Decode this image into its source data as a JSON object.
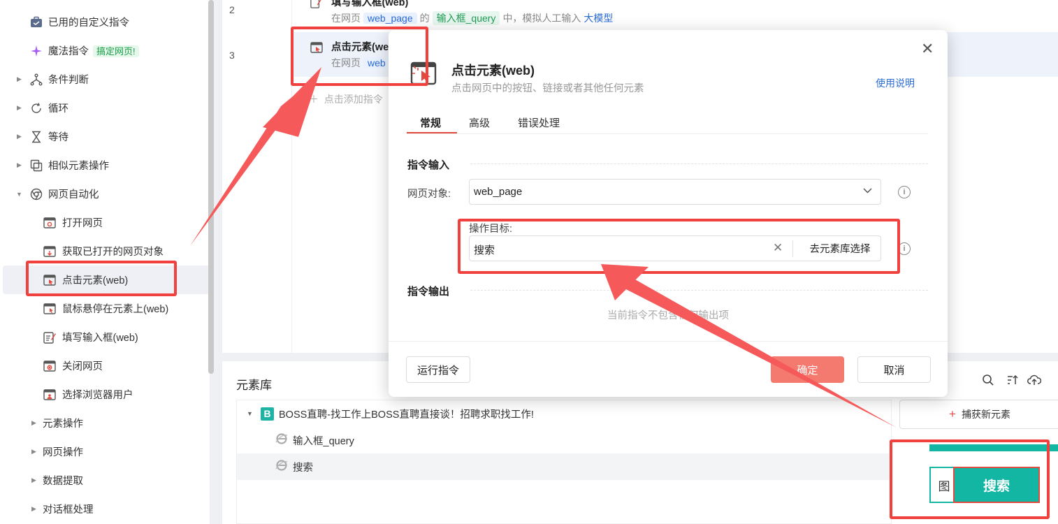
{
  "sidebar": {
    "items": [
      {
        "label": "已用的自定义指令",
        "icon": "briefcase-icon",
        "indent": 0,
        "caret": false
      },
      {
        "label": "魔法指令",
        "icon": "sparkle-icon",
        "indent": 0,
        "caret": false,
        "badge": "搞定网页!"
      },
      {
        "label": "条件判断",
        "icon": "branch-icon",
        "indent": 0,
        "caret": true
      },
      {
        "label": "循环",
        "icon": "loop-icon",
        "indent": 0,
        "caret": true
      },
      {
        "label": "等待",
        "icon": "hourglass-icon",
        "indent": 0,
        "caret": true
      },
      {
        "label": "相似元素操作",
        "icon": "copy-icon",
        "indent": 0,
        "caret": true
      },
      {
        "label": "网页自动化",
        "icon": "chrome-icon",
        "indent": 0,
        "caret": true,
        "expanded": true
      },
      {
        "label": "打开网页",
        "icon": "browser-open-icon",
        "indent": 1
      },
      {
        "label": "获取已打开的网页对象",
        "icon": "browser-get-icon",
        "indent": 1
      },
      {
        "label": "点击元素(web)",
        "icon": "click-element-icon",
        "indent": 1,
        "active": true
      },
      {
        "label": "鼠标悬停在元素上(web)",
        "icon": "hover-icon",
        "indent": 1
      },
      {
        "label": "填写输入框(web)",
        "icon": "edit-input-icon",
        "indent": 1
      },
      {
        "label": "关闭网页",
        "icon": "browser-close-icon",
        "indent": 1
      },
      {
        "label": "选择浏览器用户",
        "icon": "browser-user-icon",
        "indent": 1
      },
      {
        "label": "元素操作",
        "indent": 2,
        "caret": true
      },
      {
        "label": "网页操作",
        "indent": 2,
        "caret": true
      },
      {
        "label": "数据提取",
        "indent": 2,
        "caret": true
      },
      {
        "label": "对话框处理",
        "indent": 2,
        "caret": true
      }
    ]
  },
  "commands": {
    "row2": {
      "num": "2",
      "title": "填写输入框(web)",
      "desc_prefix": "在网页",
      "page_tag": "web_page",
      "desc_of": "的",
      "input_tag": "输入框_query",
      "desc_mid": "中，模拟人工输入",
      "link": "大模型"
    },
    "row3": {
      "num": "3",
      "title": "点击元素(we",
      "desc_prefix": "在网页",
      "page_tag": "web"
    },
    "add_label": "点击添加指令"
  },
  "modal": {
    "title": "点击元素(web)",
    "subtitle": "点击网页中的按钮、链接或者其他任何元素",
    "help_link": "使用说明",
    "tabs": [
      "常规",
      "高级",
      "错误处理"
    ],
    "input_section": "指令输入",
    "page_label": "网页对象:",
    "page_value": "web_page",
    "target_label": "操作目标:",
    "target_value": "搜索",
    "target_button": "去元素库选择",
    "output_section": "指令输出",
    "no_output": "当前指令不包含任何输出项",
    "run_button": "运行指令",
    "ok_button": "确定",
    "cancel_button": "取消"
  },
  "element_library": {
    "title": "元素库",
    "tools": [
      "search-icon",
      "sort-icon",
      "upload-icon"
    ],
    "group": {
      "badge": "B",
      "title": "BOSS直聘-找工作上BOSS直聘直接谈！招聘求职找工作!"
    },
    "items": [
      "输入框_query",
      "搜索"
    ],
    "capture_button": "捕获新元素",
    "preview": {
      "left_text": "图",
      "button_text": "搜索"
    }
  },
  "colors": {
    "accent": "#f0413e",
    "primary_button": "#f47a6f",
    "teal": "#13b5a3",
    "link": "#2a6bd6"
  }
}
